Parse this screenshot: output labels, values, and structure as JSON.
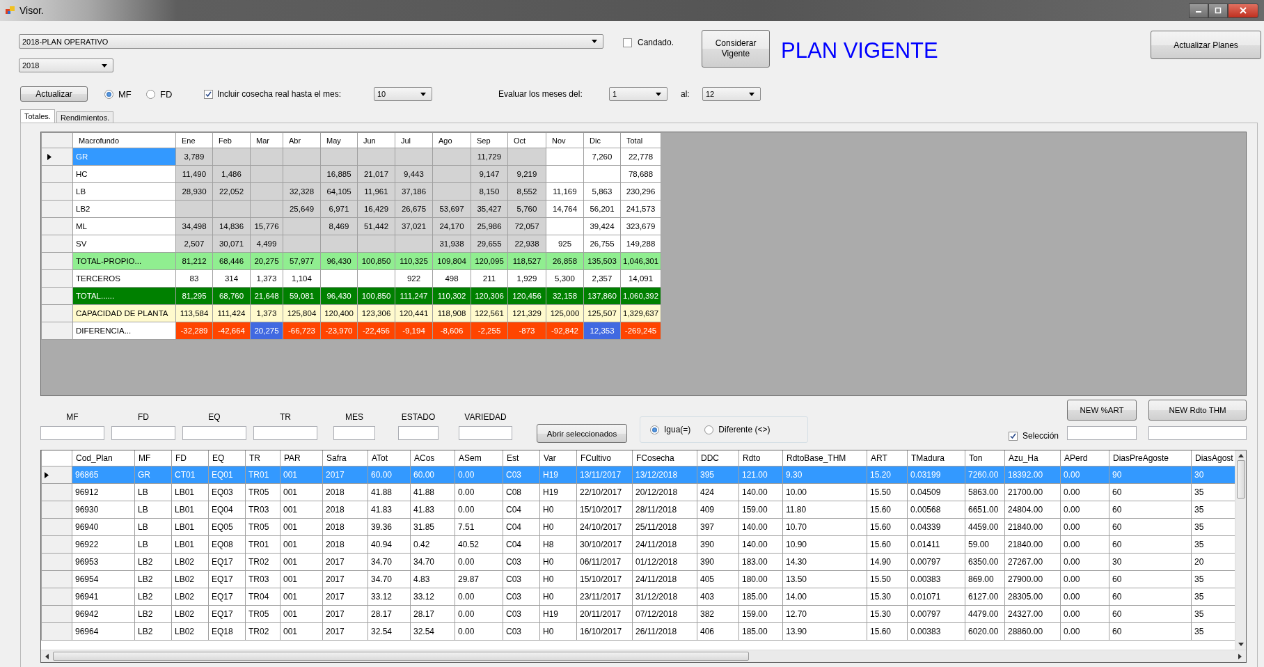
{
  "window": {
    "title": "Visor."
  },
  "plan_combo": {
    "value": "2018-PLAN OPERATIVO"
  },
  "candado": {
    "label": "Candado.",
    "checked": false
  },
  "considerar_button": "Considerar Vigente",
  "plan_status": "PLAN VIGENTE",
  "actualizar_planes_button": "Actualizar Planes",
  "year_combo": {
    "value": "2018"
  },
  "actualizar_button": "Actualizar",
  "mode_radios": [
    {
      "label": "MF",
      "selected": true
    },
    {
      "label": "FD",
      "selected": false
    }
  ],
  "incluir": {
    "label": "Incluir cosecha real hasta el mes:",
    "checked": true,
    "value": "10"
  },
  "evaluar": {
    "label": "Evaluar los meses del:",
    "from": "1",
    "to_label": "al:",
    "to": "12"
  },
  "tabs": [
    {
      "label": "Totales.",
      "selected": true
    },
    {
      "label": "Rendimientos.",
      "selected": false
    }
  ],
  "totals_table": {
    "columns": [
      {
        "label": "Macrofundo"
      },
      {
        "label": "Ene",
        "real": true
      },
      {
        "label": "Feb",
        "real": true
      },
      {
        "label": "Mar",
        "real": true
      },
      {
        "label": "Abr",
        "real": true
      },
      {
        "label": "May",
        "real": true
      },
      {
        "label": "Jun",
        "real": true
      },
      {
        "label": "Jul",
        "real": true
      },
      {
        "label": "Ago",
        "real": true
      },
      {
        "label": "Sep",
        "real": true
      },
      {
        "label": "Oct",
        "real": true
      },
      {
        "label": "Nov",
        "real": false
      },
      {
        "label": "Dic",
        "real": false
      },
      {
        "label": "Total"
      }
    ],
    "rows": [
      {
        "kind": "data",
        "selected": true,
        "cells": [
          "GR",
          "3,789",
          null,
          null,
          null,
          null,
          null,
          null,
          null,
          "11,729",
          null,
          null,
          "7,260",
          "22,778"
        ]
      },
      {
        "kind": "data",
        "selected": false,
        "cells": [
          "HC",
          "11,490",
          "1,486",
          null,
          null,
          "16,885",
          "21,017",
          "9,443",
          null,
          "9,147",
          "9,219",
          null,
          null,
          "78,688"
        ]
      },
      {
        "kind": "data",
        "selected": false,
        "cells": [
          "LB",
          "28,930",
          "22,052",
          null,
          "32,328",
          "64,105",
          "11,961",
          "37,186",
          null,
          "8,150",
          "8,552",
          "11,169",
          "5,863",
          "230,296"
        ]
      },
      {
        "kind": "data",
        "selected": false,
        "cells": [
          "LB2",
          null,
          null,
          null,
          "25,649",
          "6,971",
          "16,429",
          "26,675",
          "53,697",
          "35,427",
          "5,760",
          "14,764",
          "56,201",
          "241,573"
        ]
      },
      {
        "kind": "data",
        "selected": false,
        "cells": [
          "ML",
          "34,498",
          "14,836",
          "15,776",
          null,
          "8,469",
          "51,442",
          "37,021",
          "24,170",
          "25,986",
          "72,057",
          null,
          "39,424",
          "323,679"
        ]
      },
      {
        "kind": "data",
        "selected": false,
        "cells": [
          "SV",
          "2,507",
          "30,071",
          "4,499",
          null,
          null,
          null,
          null,
          "31,938",
          "29,655",
          "22,938",
          "925",
          "26,755",
          "149,288"
        ]
      },
      {
        "kind": "subtotal",
        "selected": false,
        "cells": [
          "TOTAL-PROPIO...",
          "81,212",
          "68,446",
          "20,275",
          "57,977",
          "96,430",
          "100,850",
          "110,325",
          "109,804",
          "120,095",
          "118,527",
          "26,858",
          "135,503",
          "1,046,301"
        ]
      },
      {
        "kind": "third_party",
        "selected": false,
        "cells": [
          "TERCEROS",
          "83",
          "314",
          "1,373",
          "1,104",
          null,
          null,
          "922",
          "498",
          "211",
          "1,929",
          "5,300",
          "2,357",
          "14,091"
        ]
      },
      {
        "kind": "total",
        "selected": false,
        "cells": [
          "TOTAL......",
          "81,295",
          "68,760",
          "21,648",
          "59,081",
          "96,430",
          "100,850",
          "111,247",
          "110,302",
          "120,306",
          "120,456",
          "32,158",
          "137,860",
          "1,060,392"
        ]
      },
      {
        "kind": "capacity",
        "selected": false,
        "cells": [
          "CAPACIDAD DE PLANTA",
          "113,584",
          "111,424",
          "1,373",
          "125,804",
          "120,400",
          "123,306",
          "120,441",
          "118,908",
          "122,561",
          "121,329",
          "125,000",
          "125,507",
          "1,329,637"
        ]
      },
      {
        "kind": "difference",
        "selected": false,
        "cells": [
          "DIFERENCIA...",
          {
            "text": "-32,289",
            "color": "#ff4500"
          },
          {
            "text": "-42,664",
            "color": "#ff4500"
          },
          {
            "text": "20,275",
            "color": "#4169e1"
          },
          {
            "text": "-66,723",
            "color": "#ff4500"
          },
          {
            "text": "-23,970",
            "color": "#ff4500"
          },
          {
            "text": "-22,456",
            "color": "#ff4500"
          },
          {
            "text": "-9,194",
            "color": "#ff4500"
          },
          {
            "text": "-8,606",
            "color": "#ff4500"
          },
          {
            "text": "-2,255",
            "color": "#ff4500"
          },
          {
            "text": "-873",
            "color": "#ff4500"
          },
          {
            "text": "-92,842",
            "color": "#ff4500"
          },
          {
            "text": "12,353",
            "color": "#4169e1"
          },
          {
            "text": "-269,245",
            "color": "#ff4500"
          }
        ]
      }
    ]
  },
  "filters": [
    {
      "label": "MF"
    },
    {
      "label": "FD"
    },
    {
      "label": "EQ"
    },
    {
      "label": "TR"
    },
    {
      "label": "MES"
    },
    {
      "label": "ESTADO"
    },
    {
      "label": "VARIEDAD"
    }
  ],
  "abrir_button": "Abrir seleccionados",
  "compare_radios": [
    {
      "label": "Igua(=)",
      "selected": true
    },
    {
      "label": "Diferente (<>)",
      "selected": false
    }
  ],
  "seleccion": {
    "label": "Selección",
    "checked": true
  },
  "new_buttons": [
    "NEW %ART",
    "NEW Rdto THM"
  ],
  "plans_table": {
    "columns": [
      "Cod_Plan",
      "MF",
      "FD",
      "EQ",
      "TR",
      "PAR",
      "Safra",
      "ATot",
      "ACos",
      "ASem",
      "Est",
      "Var",
      "FCultivo",
      "FCosecha",
      "DDC",
      "Rdto",
      "RdtoBase_THM",
      "ART",
      "TMadura",
      "Ton",
      "Azu_Ha",
      "APerd",
      "DiasPreAgoste",
      "DiasAgost"
    ],
    "rows": [
      {
        "selected": true,
        "cells": [
          "96865",
          "GR",
          "CT01",
          "EQ01",
          "TR01",
          "001",
          "2017",
          "60.00",
          "60.00",
          "0.00",
          "C03",
          "H19",
          "13/11/2017",
          "13/12/2018",
          "395",
          "121.00",
          "9.30",
          "15.20",
          "0.03199",
          "7260.00",
          "18392.00",
          "0.00",
          "90",
          "30"
        ]
      },
      {
        "selected": false,
        "cells": [
          "96912",
          "LB",
          "LB01",
          "EQ03",
          "TR05",
          "001",
          "2018",
          "41.88",
          "41.88",
          "0.00",
          "C08",
          "H19",
          "22/10/2017",
          "20/12/2018",
          "424",
          "140.00",
          "10.00",
          "15.50",
          "0.04509",
          "5863.00",
          "21700.00",
          "0.00",
          "60",
          "35"
        ]
      },
      {
        "selected": false,
        "cells": [
          "96930",
          "LB",
          "LB01",
          "EQ04",
          "TR03",
          "001",
          "2018",
          "41.83",
          "41.83",
          "0.00",
          "C04",
          "H0",
          "15/10/2017",
          "28/11/2018",
          "409",
          "159.00",
          "11.80",
          "15.60",
          "0.00568",
          "6651.00",
          "24804.00",
          "0.00",
          "60",
          "35"
        ]
      },
      {
        "selected": false,
        "cells": [
          "96940",
          "LB",
          "LB01",
          "EQ05",
          "TR05",
          "001",
          "2018",
          "39.36",
          "31.85",
          "7.51",
          "C04",
          "H0",
          "24/10/2017",
          "25/11/2018",
          "397",
          "140.00",
          "10.70",
          "15.60",
          "0.04339",
          "4459.00",
          "21840.00",
          "0.00",
          "60",
          "35"
        ]
      },
      {
        "selected": false,
        "cells": [
          "96922",
          "LB",
          "LB01",
          "EQ08",
          "TR01",
          "001",
          "2018",
          "40.94",
          "0.42",
          "40.52",
          "C04",
          "H8",
          "30/10/2017",
          "24/11/2018",
          "390",
          "140.00",
          "10.90",
          "15.60",
          "0.01411",
          "59.00",
          "21840.00",
          "0.00",
          "60",
          "35"
        ]
      },
      {
        "selected": false,
        "cells": [
          "96953",
          "LB2",
          "LB02",
          "EQ17",
          "TR02",
          "001",
          "2017",
          "34.70",
          "34.70",
          "0.00",
          "C03",
          "H0",
          "06/11/2017",
          "01/12/2018",
          "390",
          "183.00",
          "14.30",
          "14.90",
          "0.00797",
          "6350.00",
          "27267.00",
          "0.00",
          "30",
          "20"
        ]
      },
      {
        "selected": false,
        "cells": [
          "96954",
          "LB2",
          "LB02",
          "EQ17",
          "TR03",
          "001",
          "2017",
          "34.70",
          "4.83",
          "29.87",
          "C03",
          "H0",
          "15/10/2017",
          "24/11/2018",
          "405",
          "180.00",
          "13.50",
          "15.50",
          "0.00383",
          "869.00",
          "27900.00",
          "0.00",
          "60",
          "35"
        ]
      },
      {
        "selected": false,
        "cells": [
          "96941",
          "LB2",
          "LB02",
          "EQ17",
          "TR04",
          "001",
          "2017",
          "33.12",
          "33.12",
          "0.00",
          "C03",
          "H0",
          "23/11/2017",
          "31/12/2018",
          "403",
          "185.00",
          "14.00",
          "15.30",
          "0.01071",
          "6127.00",
          "28305.00",
          "0.00",
          "60",
          "35"
        ]
      },
      {
        "selected": false,
        "cells": [
          "96942",
          "LB2",
          "LB02",
          "EQ17",
          "TR05",
          "001",
          "2017",
          "28.17",
          "28.17",
          "0.00",
          "C03",
          "H19",
          "20/11/2017",
          "07/12/2018",
          "382",
          "159.00",
          "12.70",
          "15.30",
          "0.00797",
          "4479.00",
          "24327.00",
          "0.00",
          "60",
          "35"
        ]
      },
      {
        "selected": false,
        "cells": [
          "96964",
          "LB2",
          "LB02",
          "EQ18",
          "TR02",
          "001",
          "2017",
          "32.54",
          "32.54",
          "0.00",
          "C03",
          "H0",
          "16/10/2017",
          "26/11/2018",
          "406",
          "185.00",
          "13.90",
          "15.60",
          "0.00383",
          "6020.00",
          "28860.00",
          "0.00",
          "60",
          "35"
        ]
      }
    ]
  }
}
